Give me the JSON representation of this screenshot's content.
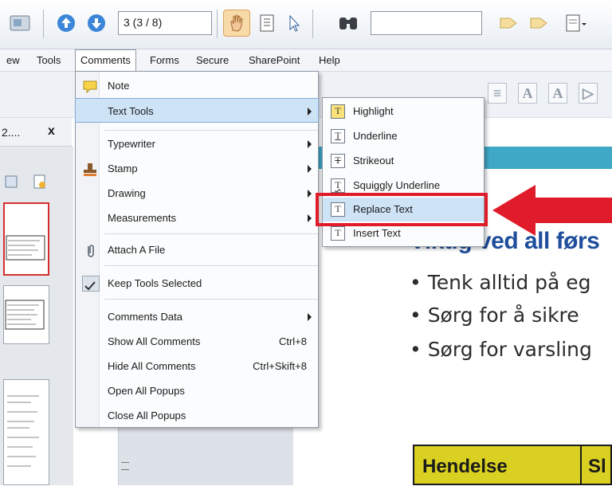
{
  "toolbar": {
    "page_field": "3 (3 / 8)",
    "search_placeholder": ""
  },
  "menubar": {
    "items": [
      "ew",
      "Tools",
      "Comments",
      "Forms",
      "Secure",
      "SharePoint",
      "Help"
    ]
  },
  "tab": {
    "label": "2....",
    "close": "x"
  },
  "comments_menu": {
    "items": [
      {
        "label": "Note",
        "icon": "note-icon"
      },
      {
        "label": "Text Tools",
        "has_submenu": true
      },
      {
        "label": "Typewriter",
        "has_submenu": true
      },
      {
        "label": "Stamp",
        "icon": "stamp-icon",
        "has_submenu": true
      },
      {
        "label": "Drawing",
        "has_submenu": true
      },
      {
        "label": "Measurements",
        "has_submenu": true
      },
      {
        "label": "Attach A File",
        "icon": "paperclip-icon"
      },
      {
        "label": "Keep Tools Selected",
        "icon": "checkmark-icon"
      },
      {
        "label": "Comments Data",
        "has_submenu": true
      },
      {
        "label": "Show All Comments",
        "shortcut": "Ctrl+8"
      },
      {
        "label": "Hide All Comments",
        "shortcut": "Ctrl+Skift+8"
      },
      {
        "label": "Open All Popups"
      },
      {
        "label": "Close All Popups"
      }
    ]
  },
  "text_tools_submenu": {
    "items": [
      {
        "label": "Highlight",
        "glyph": "T"
      },
      {
        "label": "Underline",
        "glyph": "T"
      },
      {
        "label": "Strikeout",
        "glyph": "T"
      },
      {
        "label": "Squiggly Underline",
        "glyph": "T"
      },
      {
        "label": "Replace Text",
        "glyph": "T"
      },
      {
        "label": "Insert Text",
        "glyph": "T"
      }
    ]
  },
  "document": {
    "heading": "Viktig ved all førs",
    "bullets": [
      "• Tenk alltid på eg",
      "• Sørg for å sikre",
      "• Sørg for varsling"
    ],
    "table_headers": [
      "Hendelse",
      "Sl"
    ]
  },
  "colors": {
    "highlight": "#cfe3f7",
    "annotation_red": "#e01b2a",
    "heading_blue": "#1f4e9c",
    "table_yellow": "#d9d021"
  }
}
